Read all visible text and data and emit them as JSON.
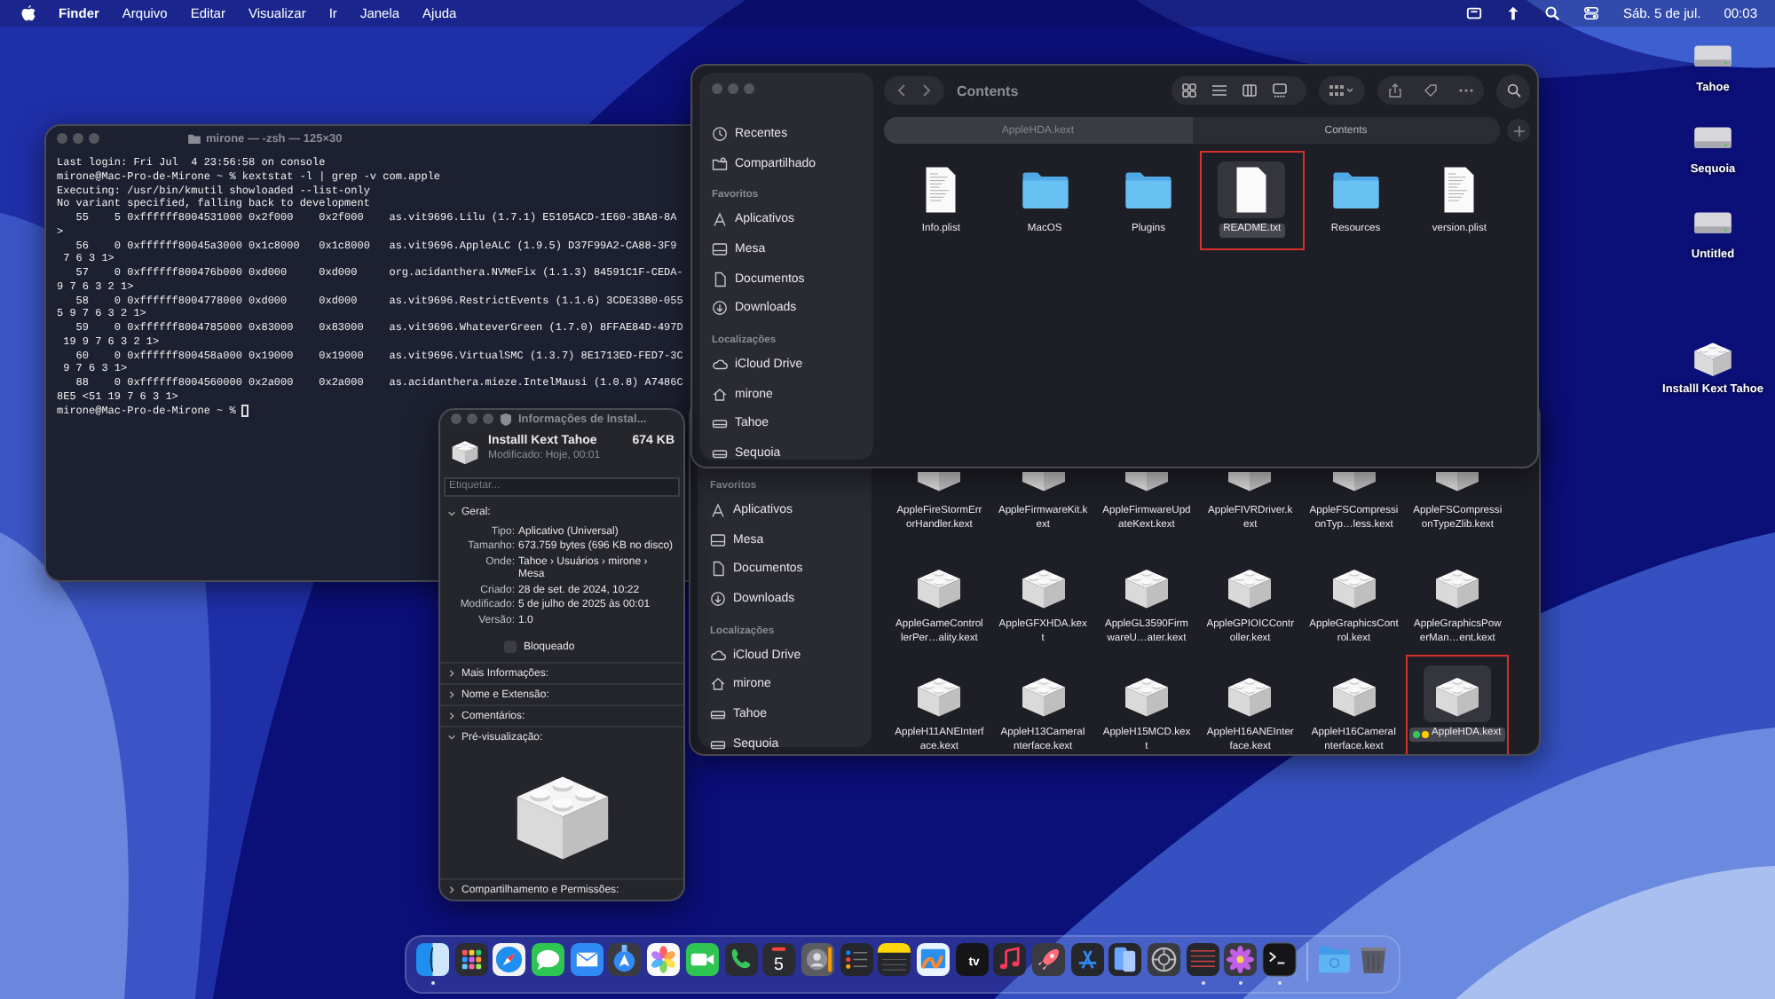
{
  "menu_bar": {
    "app_name": "Finder",
    "menus": [
      "Arquivo",
      "Editar",
      "Visualizar",
      "Ir",
      "Janela",
      "Ajuda"
    ],
    "date": "Sáb. 5 de jul.",
    "time": "00:03"
  },
  "desktop_icons": [
    {
      "label": "Tahoe",
      "kind": "drive"
    },
    {
      "label": "Sequoia",
      "kind": "drive"
    },
    {
      "label": "Untitled",
      "kind": "drive"
    },
    {
      "label": "Installl Kext Tahoe",
      "kind": "package"
    }
  ],
  "terminal": {
    "title": "mirone — -zsh — 125×30",
    "cursor": true,
    "lines": [
      "Last login: Fri Jul  4 23:56:58 on console",
      "mirone@Mac-Pro-de-Mirone ~ % kextstat -l | grep -v com.apple",
      "Executing: /usr/bin/kmutil showloaded --list-only",
      "No variant specified, falling back to development",
      "   55    5 0xffffff8004531000 0x2f000    0x2f000    as.vit9696.Lilu (1.7.1) E5105ACD-1E60-3BA8-8A",
      ">",
      "   56    0 0xffffff80045a3000 0x1c8000   0x1c8000   as.vit9696.AppleALC (1.9.5) D37F99A2-CA88-3F9",
      " 7 6 3 1>",
      "   57    0 0xffffff800476b000 0xd000     0xd000     org.acidanthera.NVMeFix (1.1.3) 84591C1F-CEDA-",
      "9 7 6 3 2 1>",
      "   58    0 0xffffff8004778000 0xd000     0xd000     as.vit9696.RestrictEvents (1.1.6) 3CDE33B0-055",
      "5 9 7 6 3 2 1>",
      "   59    0 0xffffff8004785000 0x83000    0x83000    as.vit9696.WhateverGreen (1.7.0) 8FFAE84D-497D",
      " 19 9 7 6 3 2 1>",
      "   60    0 0xffffff800458a000 0x19000    0x19000    as.vit9696.VirtualSMC (1.3.7) 8E1713ED-FED7-3C",
      " 9 7 6 3 1>",
      "   88    0 0xffffff8004560000 0x2a000    0x2a000    as.acidanthera.mieze.IntelMausi (1.0.8) A7486C",
      "8E5 <51 19 7 6 3 1>",
      "mirone@Mac-Pro-de-Mirone ~ % "
    ]
  },
  "finder_back": {
    "sidebar": [
      {
        "heading": "Favoritos",
        "items": [
          {
            "label": "Aplicativos",
            "kind": "apps"
          },
          {
            "label": "Mesa",
            "kind": "desktop"
          },
          {
            "label": "Documentos",
            "kind": "document"
          },
          {
            "label": "Downloads",
            "kind": "download"
          }
        ]
      },
      {
        "heading": "Localizações",
        "items": [
          {
            "label": "iCloud Drive",
            "kind": "cloud"
          },
          {
            "label": "mirone",
            "kind": "home"
          },
          {
            "label": "Tahoe",
            "kind": "drive"
          },
          {
            "label": "Sequoia",
            "kind": "drive"
          }
        ]
      }
    ],
    "files": [
      {
        "name": "AppleFireStormErrorHandler.kext",
        "selected": false,
        "highlighted": false
      },
      {
        "name": "AppleFirmwareKit.kext",
        "selected": false,
        "highlighted": false
      },
      {
        "name": "AppleFirmwareUpdateKext.kext",
        "selected": false,
        "highlighted": false
      },
      {
        "name": "AppleFIVRDriver.kext",
        "selected": false,
        "highlighted": false
      },
      {
        "name": "AppleFSCompressionTyp…less.kext",
        "selected": false,
        "highlighted": false
      },
      {
        "name": "AppleFSCompressionTypeZlib.kext",
        "selected": false,
        "highlighted": false
      },
      {
        "name": "AppleGameControllerPer…ality.kext",
        "selected": false,
        "highlighted": false
      },
      {
        "name": "AppleGFXHDA.kext",
        "selected": false,
        "highlighted": false
      },
      {
        "name": "AppleGL3590FirmwareU…ater.kext",
        "selected": false,
        "highlighted": false
      },
      {
        "name": "AppleGPIOICController.kext",
        "selected": false,
        "highlighted": false
      },
      {
        "name": "AppleGraphicsControl.kext",
        "selected": false,
        "highlighted": false
      },
      {
        "name": "AppleGraphicsPowerMan…ent.kext",
        "selected": false,
        "highlighted": false
      },
      {
        "name": "AppleH11ANEInterface.kext",
        "selected": false,
        "highlighted": false
      },
      {
        "name": "AppleH13CameraInterface.kext",
        "selected": false,
        "highlighted": false
      },
      {
        "name": "AppleH15MCD.kext",
        "selected": false,
        "highlighted": false
      },
      {
        "name": "AppleH16ANEInterface.kext",
        "selected": false,
        "highlighted": false
      },
      {
        "name": "AppleH16CameraInterface.kext",
        "selected": false,
        "highlighted": false
      },
      {
        "name": "AppleHDA.kext",
        "selected": true,
        "highlighted": true,
        "tags": [
          {
            "color": "#34c759"
          },
          {
            "color": "#ffcc00"
          }
        ]
      }
    ]
  },
  "finder_front": {
    "title": "Contents",
    "tabs": [
      {
        "label": "AppleHDA.kext",
        "selected": false
      },
      {
        "label": "Contents",
        "selected": true
      }
    ],
    "sidebar": [
      {
        "items": [
          {
            "label": "Recentes",
            "kind": "clock"
          },
          {
            "label": "Compartilhado",
            "kind": "shared"
          }
        ]
      },
      {
        "heading": "Favoritos",
        "items": [
          {
            "label": "Aplicativos",
            "kind": "apps"
          },
          {
            "label": "Mesa",
            "kind": "desktop"
          },
          {
            "label": "Documentos",
            "kind": "document"
          },
          {
            "label": "Downloads",
            "kind": "download"
          }
        ]
      },
      {
        "heading": "Localizações",
        "items": [
          {
            "label": "iCloud Drive",
            "kind": "cloud"
          },
          {
            "label": "mirone",
            "kind": "home"
          },
          {
            "label": "Tahoe",
            "kind": "drive"
          },
          {
            "label": "Sequoia",
            "kind": "drive"
          }
        ]
      }
    ],
    "files": [
      {
        "name": "Info.plist",
        "kind": "plist",
        "selected": false,
        "highlighted": false
      },
      {
        "name": "MacOS",
        "kind": "folder",
        "selected": false,
        "highlighted": false
      },
      {
        "name": "Plugins",
        "kind": "folder",
        "selected": false,
        "highlighted": false
      },
      {
        "name": "README.txt",
        "kind": "text",
        "selected": true,
        "highlighted": true
      },
      {
        "name": "Resources",
        "kind": "folder",
        "selected": false,
        "highlighted": false
      },
      {
        "name": "version.plist",
        "kind": "plist",
        "selected": false,
        "highlighted": false
      }
    ]
  },
  "info_window": {
    "title": "Informações de Instal...",
    "name": "Installl Kext Tahoe",
    "size": "674 KB",
    "modified": "Modificado: Hoje, 00:01",
    "tags_placeholder": "Etiquetar...",
    "sections": [
      {
        "title": "Geral:",
        "kind": "general",
        "expanded": true,
        "rows": [
          {
            "label": "Tipo:",
            "value": "Aplicativo (Universal)"
          },
          {
            "label": "Tamanho:",
            "value": "673.759 bytes (696 KB no disco)"
          },
          {
            "label": "Onde:",
            "value": "Tahoe › Usuários › mirone › Mesa"
          },
          {
            "label": "Criado:",
            "value": "28 de set. de 2024, 10:22"
          },
          {
            "label": "Modificado:",
            "value": "5 de julho de 2025 às 00:01"
          },
          {
            "label": "Versão:",
            "value": "1.0"
          }
        ],
        "locked": {
          "label": "Bloqueado",
          "checked": false
        }
      },
      {
        "title": "Mais Informações:",
        "expanded": false
      },
      {
        "title": "Nome e Extensão:",
        "expanded": false
      },
      {
        "title": "Comentários:",
        "expanded": false
      },
      {
        "title": "Pré-visualização:",
        "kind": "preview",
        "expanded": true
      },
      {
        "title": "Compartilhamento e Permissões:",
        "expanded": false
      }
    ]
  },
  "dock": [
    {
      "kind": "finder",
      "running": true
    },
    {
      "kind": "launchpad",
      "running": false
    },
    {
      "kind": "safari",
      "running": false
    },
    {
      "kind": "messages",
      "running": false
    },
    {
      "kind": "mail",
      "running": false
    },
    {
      "kind": "location",
      "running": false
    },
    {
      "kind": "photos",
      "running": false
    },
    {
      "kind": "facetime",
      "running": false
    },
    {
      "kind": "phone",
      "running": false
    },
    {
      "kind": "calendar",
      "label": "5",
      "running": false
    },
    {
      "kind": "contacts",
      "running": false
    },
    {
      "kind": "reminders",
      "running": false
    },
    {
      "kind": "notes",
      "running": false
    },
    {
      "kind": "freeform",
      "running": false
    },
    {
      "kind": "tv",
      "label": "tv",
      "running": false
    },
    {
      "kind": "music",
      "running": false
    },
    {
      "kind": "rocket",
      "running": false
    },
    {
      "kind": "appstore",
      "running": false
    },
    {
      "kind": "phones",
      "running": false
    },
    {
      "kind": "settings",
      "running": false
    },
    {
      "kind": "ledger",
      "running": true
    },
    {
      "kind": "daisy",
      "running": true
    },
    {
      "kind": "terminal",
      "running": true
    },
    {
      "kind": "separator"
    },
    {
      "kind": "folder",
      "running": false
    },
    {
      "kind": "trash",
      "running": false
    }
  ]
}
